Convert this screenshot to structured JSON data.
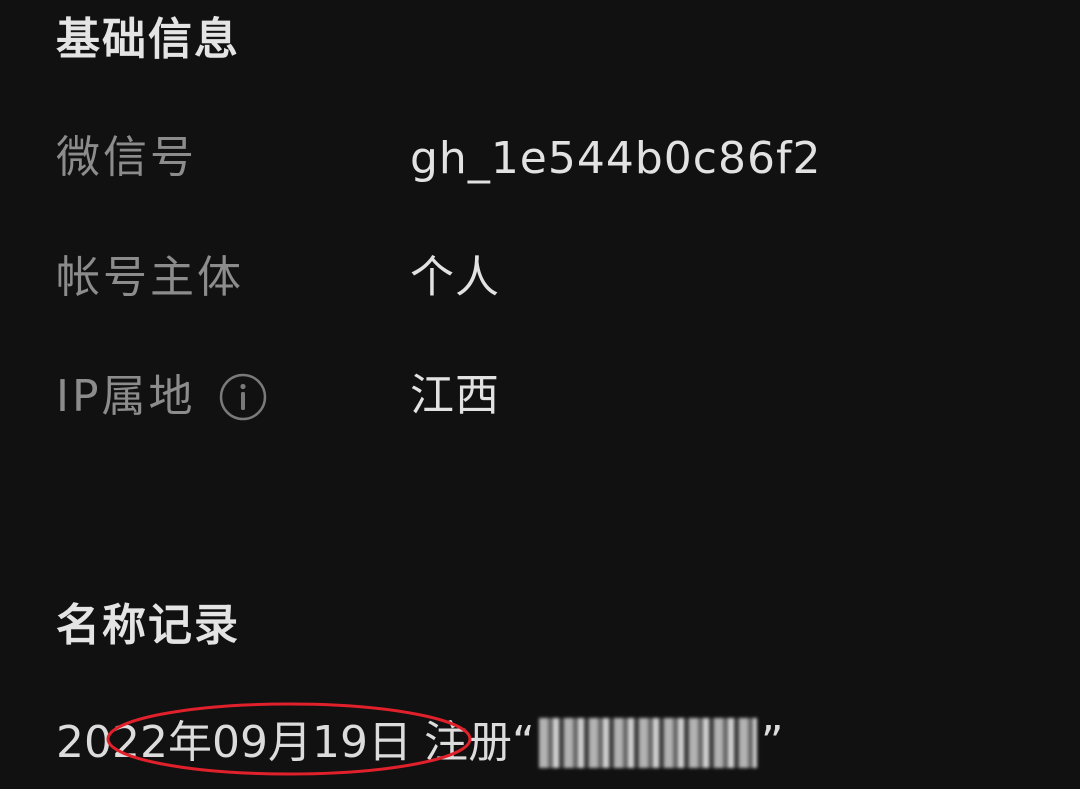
{
  "basic_info": {
    "title": "基础信息",
    "rows": [
      {
        "label": "微信号",
        "value": "gh_1e544b0c86f2"
      },
      {
        "label": "帐号主体",
        "value": "个人"
      },
      {
        "label": "IP属地",
        "value": "江西",
        "icon": "info-icon"
      }
    ]
  },
  "name_record": {
    "title": "名称记录",
    "entries": [
      {
        "date": "2022年09月19日",
        "action": "注册",
        "open_quote": "“",
        "close_quote": "”"
      }
    ]
  },
  "colors": {
    "background": "#111111",
    "annotation_circle": "#e0202a"
  }
}
